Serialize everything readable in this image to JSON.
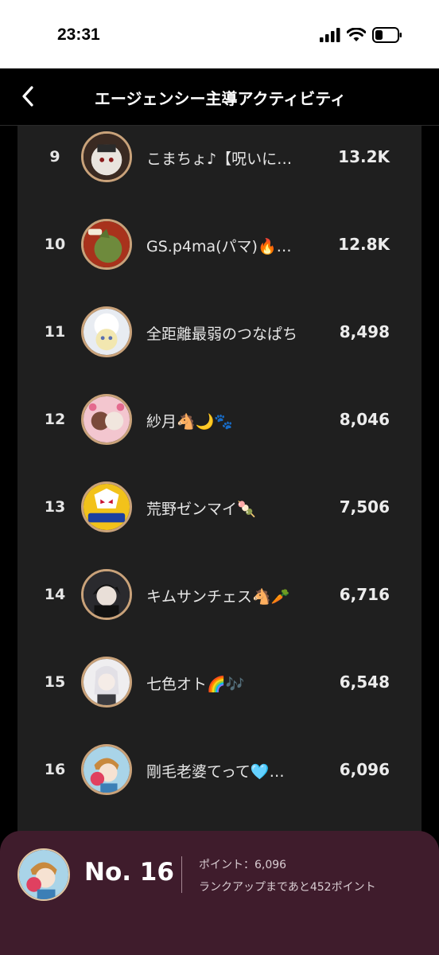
{
  "status_bar": {
    "time": "23:31"
  },
  "header": {
    "title": "エージェンシー主導アクティビティ"
  },
  "ranking": [
    {
      "rank": "9",
      "name": "こまちょ♪【呪いに…",
      "points": "13.2K"
    },
    {
      "rank": "10",
      "name": "GS.p4ma(パマ)🔥…",
      "points": "12.8K"
    },
    {
      "rank": "11",
      "name": "全距離最弱のつなぱち",
      "points": "8,498"
    },
    {
      "rank": "12",
      "name": "紗月🐴🌙🐾",
      "points": "8,046"
    },
    {
      "rank": "13",
      "name": "荒野ゼンマイ🍡",
      "points": "7,506"
    },
    {
      "rank": "14",
      "name": "キムサンチェス🐴🥕",
      "points": "6,716"
    },
    {
      "rank": "15",
      "name": "七色オト🌈🎶",
      "points": "6,548"
    },
    {
      "rank": "16",
      "name": "剛毛老婆てって🩵…",
      "points": "6,096"
    }
  ],
  "my_rank": {
    "rank_label": "No. 16",
    "points_label": "ポイント：6,096",
    "rank_up_label": "ランクアップまであと452ポイント"
  },
  "colors": {
    "accent_card": "#3f1c2c",
    "panel": "#1f1f1f",
    "avatar_ring": "#c9a27a"
  }
}
